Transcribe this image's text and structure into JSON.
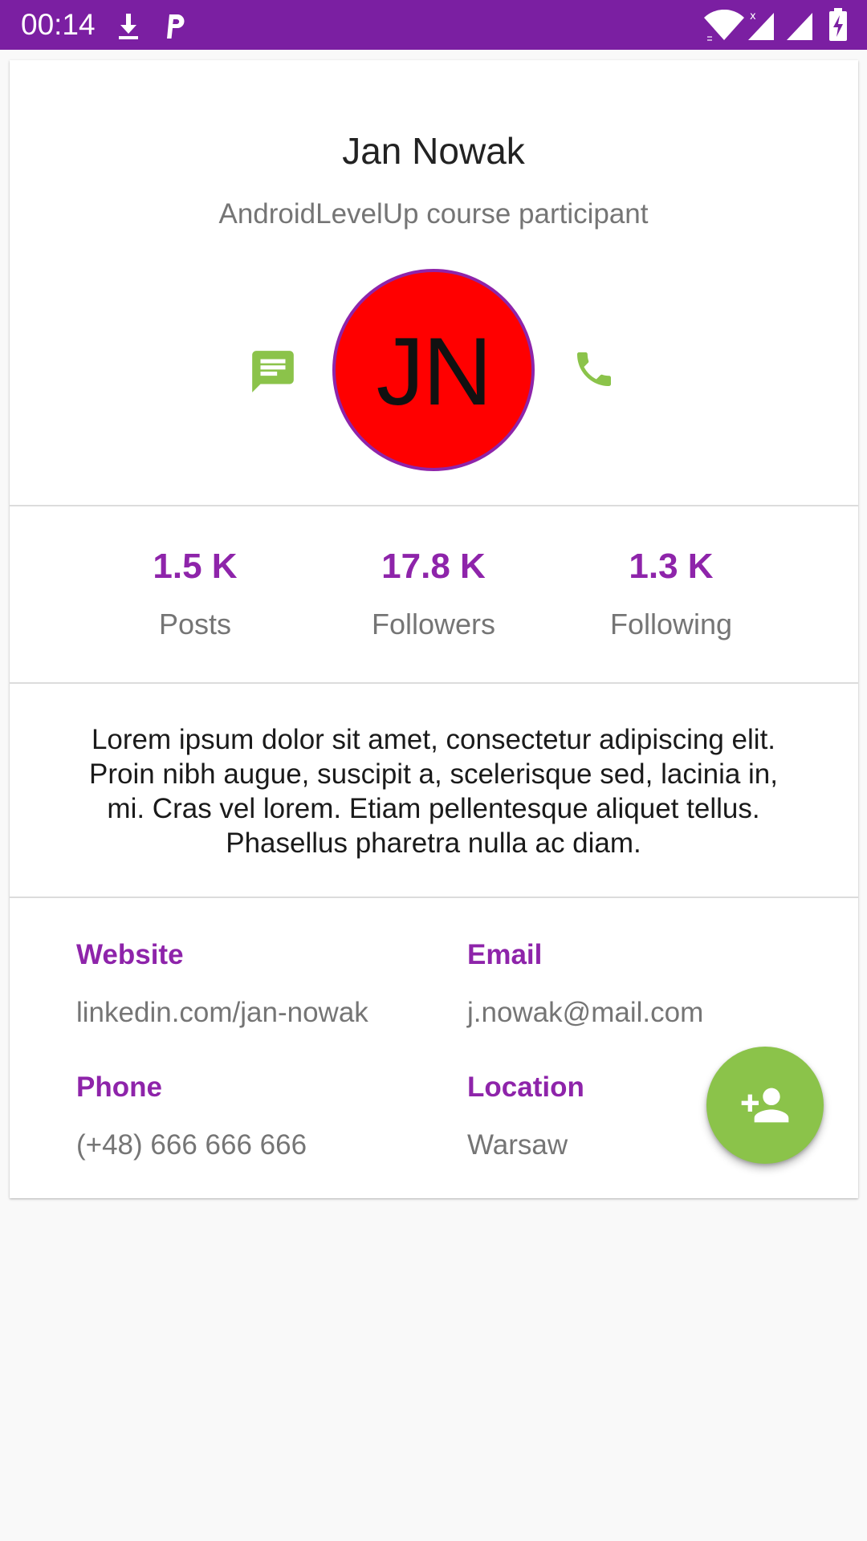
{
  "status_bar": {
    "time": "00:14",
    "icons": [
      "download-icon",
      "parking-app-icon",
      "wifi-icon",
      "signal-icon",
      "battery-charging-icon"
    ]
  },
  "profile": {
    "name": "Jan Nowak",
    "subtitle": "AndroidLevelUp course participant",
    "avatar_initials": "JN",
    "avatar_color": "#ff0000",
    "avatar_border_color": "#8e24aa"
  },
  "actions": {
    "message_icon": "message-icon",
    "call_icon": "phone-icon",
    "action_color": "#8bc34a"
  },
  "stats": [
    {
      "value": "1.5 K",
      "label": "Posts"
    },
    {
      "value": "17.8 K",
      "label": "Followers"
    },
    {
      "value": "1.3 K",
      "label": "Following"
    }
  ],
  "bio": "Lorem ipsum dolor sit amet, consectetur adipiscing elit. Proin nibh augue, suscipit a, scelerisque sed, lacinia in, mi. Cras vel lorem. Etiam pellentesque aliquet tellus. Phasellus pharetra nulla ac diam.",
  "info": {
    "website": {
      "label": "Website",
      "value": "linkedin.com/jan-nowak"
    },
    "email": {
      "label": "Email",
      "value": "j.nowak@mail.com"
    },
    "phone": {
      "label": "Phone",
      "value": "(+48) 666 666 666"
    },
    "location": {
      "label": "Location",
      "value": "Warsaw"
    }
  },
  "fab": {
    "icon": "add-person-icon"
  },
  "colors": {
    "primary_dark": "#7b1fa2",
    "accent": "#8e24aa",
    "fab": "#8bc34a",
    "text_secondary": "#757575"
  }
}
